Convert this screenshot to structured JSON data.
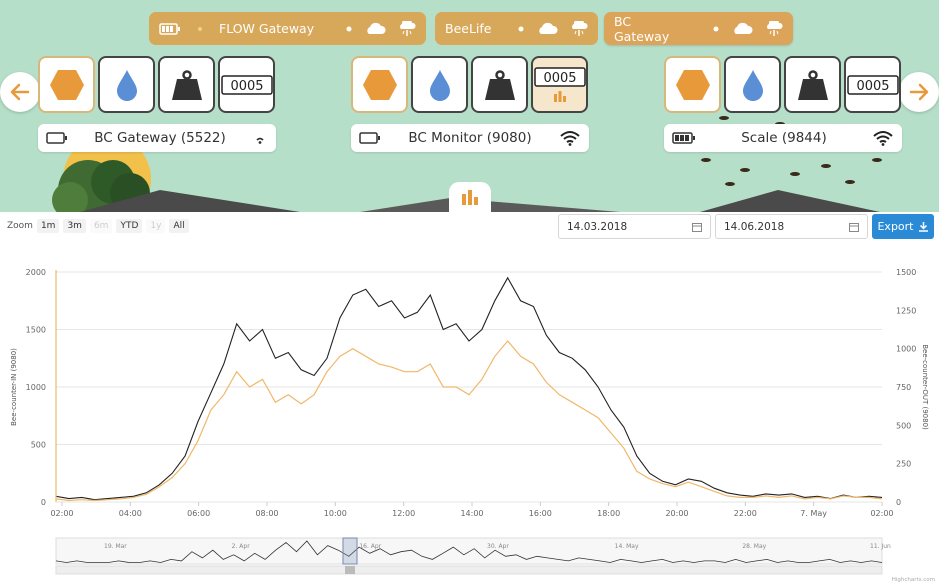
{
  "gateways": [
    {
      "name": "FLOW Gateway"
    },
    {
      "name": "BeeLife"
    },
    {
      "name": "BC Gateway"
    }
  ],
  "devices": [
    {
      "label": "BC Gateway (5522)",
      "counter": "0005"
    },
    {
      "label": "BC Monitor (9080)",
      "counter": "0005"
    },
    {
      "label": "Scale (9844)",
      "counter": "0005"
    }
  ],
  "icons": {
    "nav_prev": "arrow-left-icon",
    "nav_next": "arrow-right-icon",
    "hive": "hexagon-icon",
    "humidity": "water-drop-icon",
    "weight": "weight-icon",
    "counter": "counter-icon",
    "battery": "battery-icon",
    "wifi": "wifi-icon",
    "cloud": "cloud-icon",
    "rain": "rain-cloud-icon",
    "chart": "bar-chart-icon",
    "download": "download-icon"
  },
  "colors": {
    "accent": "#d7a85a",
    "bg_top": "#b6dfc9",
    "hex": "#e89a3a",
    "drop": "#5a8fd6",
    "export": "#2b8ad6",
    "series_in": "#222222",
    "series_out": "#f0b86a"
  },
  "toolbar": {
    "zoom_label": "Zoom",
    "zoom_buttons": [
      "1m",
      "3m",
      "6m",
      "YTD",
      "1y",
      "All"
    ],
    "date_from": "14.03.2018",
    "date_to": "14.06.2018",
    "export_label": "Export"
  },
  "chart_data": {
    "type": "line",
    "x": [
      "02:00",
      "02:30",
      "03:00",
      "03:30",
      "04:00",
      "04:30",
      "05:00",
      "05:30",
      "06:00",
      "06:30",
      "07:00",
      "07:30",
      "08:00",
      "08:15",
      "08:30",
      "08:45",
      "09:00",
      "09:15",
      "09:30",
      "09:45",
      "10:00",
      "10:15",
      "10:30",
      "10:45",
      "11:00",
      "11:15",
      "11:30",
      "11:45",
      "12:00",
      "12:15",
      "12:30",
      "12:45",
      "13:00",
      "13:15",
      "13:30",
      "13:45",
      "14:00",
      "14:15",
      "14:30",
      "14:45",
      "15:00",
      "15:15",
      "15:30",
      "15:45",
      "16:00",
      "16:30",
      "17:00",
      "17:30",
      "18:00",
      "18:30",
      "19:00",
      "19:30",
      "20:00",
      "20:30",
      "21:00",
      "21:30",
      "22:00",
      "22:30",
      "23:00",
      "23:30",
      "00:00",
      "00:30",
      "01:00",
      "01:30",
      "02:00"
    ],
    "x_ticks": [
      "02:00",
      "04:00",
      "06:00",
      "08:00",
      "10:00",
      "12:00",
      "14:00",
      "16:00",
      "18:00",
      "20:00",
      "22:00",
      "7. May",
      "02:00"
    ],
    "series": [
      {
        "name": "Bee-counter-IN (9080)",
        "axis": "left",
        "values": [
          50,
          30,
          40,
          20,
          30,
          40,
          50,
          80,
          150,
          250,
          400,
          700,
          950,
          1200,
          1550,
          1400,
          1500,
          1250,
          1300,
          1150,
          1100,
          1250,
          1600,
          1800,
          1850,
          1700,
          1750,
          1600,
          1650,
          1800,
          1500,
          1550,
          1400,
          1500,
          1750,
          1950,
          1750,
          1700,
          1450,
          1300,
          1250,
          1150,
          1000,
          800,
          650,
          400,
          250,
          180,
          150,
          200,
          180,
          120,
          80,
          60,
          50,
          70,
          60,
          70,
          40,
          50,
          30,
          60,
          40,
          50,
          40
        ]
      },
      {
        "name": "Bee-counter-OUT (9080)",
        "axis": "right",
        "values": [
          20,
          10,
          15,
          10,
          15,
          20,
          30,
          50,
          100,
          160,
          250,
          400,
          600,
          700,
          850,
          750,
          800,
          650,
          700,
          640,
          700,
          850,
          950,
          1000,
          950,
          900,
          880,
          850,
          850,
          900,
          750,
          750,
          700,
          800,
          950,
          1050,
          950,
          900,
          780,
          700,
          650,
          600,
          550,
          450,
          350,
          200,
          150,
          120,
          100,
          130,
          100,
          70,
          40,
          30,
          30,
          40,
          30,
          40,
          20,
          30,
          20,
          40,
          30,
          30,
          20
        ]
      }
    ],
    "ylim_left": [
      0,
      2000
    ],
    "yticks_left": [
      0,
      500,
      1000,
      1500,
      2000
    ],
    "ylim_right": [
      0,
      1500
    ],
    "yticks_right": [
      0,
      250,
      500,
      750,
      1000,
      1250,
      1500
    ],
    "ylabel_left": "Bee-counter-IN (9080)",
    "ylabel_right": "Bee-counter-OUT (9080)",
    "grid": true,
    "navigator_labels": [
      "19. Mar",
      "2. Apr",
      "16. Apr",
      "30. Apr",
      "14. May",
      "28. May",
      "11. Jun"
    ],
    "navigator_values": [
      2,
      1,
      2,
      1,
      1,
      1,
      2,
      1,
      1,
      2,
      1,
      3,
      2,
      8,
      4,
      9,
      3,
      6,
      2,
      7,
      3,
      9,
      14,
      8,
      15,
      6,
      12,
      9,
      5,
      11,
      7,
      10,
      6,
      8,
      9,
      5,
      3,
      7,
      11,
      6,
      10,
      4,
      9,
      5,
      6,
      3,
      5,
      4,
      3,
      2,
      4,
      3,
      2,
      1,
      3,
      2,
      1,
      2,
      3,
      1,
      2,
      1,
      2,
      2,
      1,
      3,
      1,
      2,
      3,
      1,
      2,
      1,
      1,
      2,
      3,
      1,
      2,
      1,
      2,
      1
    ],
    "credit": "Highcharts.com"
  }
}
